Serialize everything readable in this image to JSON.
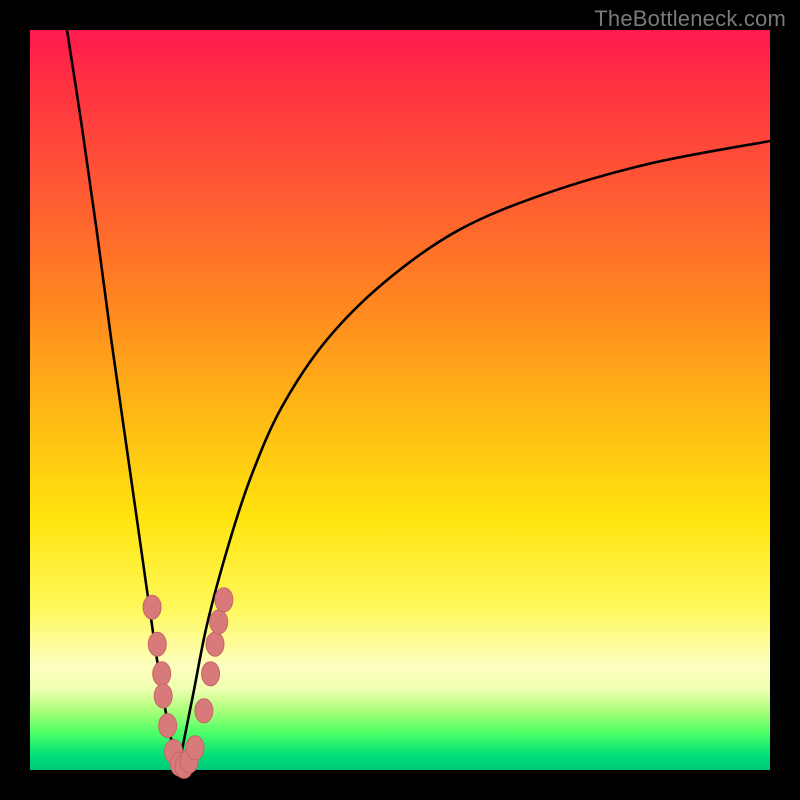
{
  "watermark": "TheBottleneck.com",
  "colors": {
    "frame": "#000000",
    "curve": "#000000",
    "marker_fill": "#d97a7a",
    "marker_stroke": "#c76666"
  },
  "chart_data": {
    "type": "line",
    "title": "",
    "xlabel": "",
    "ylabel": "",
    "xlim": [
      0,
      100
    ],
    "ylim": [
      0,
      100
    ],
    "note": "No axis ticks or numeric labels are visible; x and y are normalized 0–100. The V-shaped curve bottoms out near x≈20, y≈0 and rises steeply on both sides; the right branch asymptotes toward ~y≈85 at x=100.",
    "series": [
      {
        "name": "left-branch",
        "x": [
          5,
          7,
          9,
          11,
          13,
          15,
          17,
          18.5,
          20
        ],
        "y": [
          100,
          87,
          73,
          58,
          44,
          30,
          16,
          7,
          0
        ]
      },
      {
        "name": "right-branch",
        "x": [
          20,
          22,
          24,
          27,
          30,
          34,
          40,
          48,
          58,
          70,
          84,
          100
        ],
        "y": [
          0,
          10,
          20,
          31,
          40,
          49,
          58,
          66,
          73,
          78,
          82,
          85
        ]
      }
    ],
    "markers": {
      "name": "sample-points",
      "note": "Pink bead-like markers clustered near the valley on both branches.",
      "points": [
        {
          "x": 16.5,
          "y": 22
        },
        {
          "x": 17.2,
          "y": 17
        },
        {
          "x": 17.8,
          "y": 13
        },
        {
          "x": 18.0,
          "y": 10
        },
        {
          "x": 18.6,
          "y": 6
        },
        {
          "x": 19.4,
          "y": 2.5
        },
        {
          "x": 20.2,
          "y": 0.8
        },
        {
          "x": 20.8,
          "y": 0.5
        },
        {
          "x": 21.5,
          "y": 1.2
        },
        {
          "x": 22.3,
          "y": 3.0
        },
        {
          "x": 23.5,
          "y": 8
        },
        {
          "x": 24.4,
          "y": 13
        },
        {
          "x": 25.0,
          "y": 17
        },
        {
          "x": 25.5,
          "y": 20
        },
        {
          "x": 26.2,
          "y": 23
        }
      ]
    }
  }
}
